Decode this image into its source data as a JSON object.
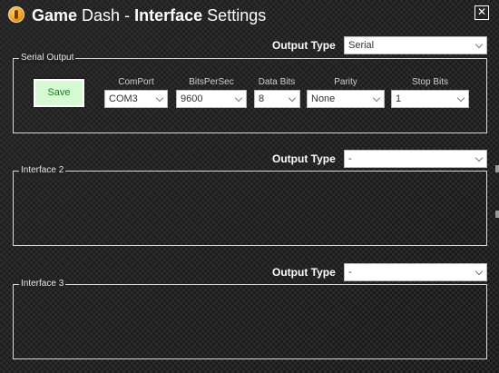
{
  "window": {
    "title_part1": "Game",
    "title_part2": "Dash",
    "title_sep": "-",
    "title_part3": "Interface",
    "title_part4": "Settings",
    "close_glyph": "✕"
  },
  "sections": [
    {
      "output_type_label": "Output Type",
      "output_type_value": "Serial",
      "legend": "Serial Output",
      "save_label": "Save",
      "fields": [
        {
          "label": "ComPort",
          "value": "COM3"
        },
        {
          "label": "BitsPerSec",
          "value": "9600"
        },
        {
          "label": "Data Bits",
          "value": "8"
        },
        {
          "label": "Parity",
          "value": "None"
        },
        {
          "label": "Stop Bits",
          "value": "1"
        }
      ]
    },
    {
      "output_type_label": "Output Type",
      "output_type_value": "-",
      "legend": "Interface 2"
    },
    {
      "output_type_label": "Output Type",
      "output_type_value": "-",
      "legend": "Interface 3"
    }
  ],
  "colors": {
    "save_bg": "#d6fbd2",
    "save_text": "#1f7a1f",
    "logo": "#f0a21c"
  },
  "icons": {
    "logo": "game-dash-logo-icon",
    "close": "close-icon",
    "dropdown": "chevron-down-icon"
  }
}
